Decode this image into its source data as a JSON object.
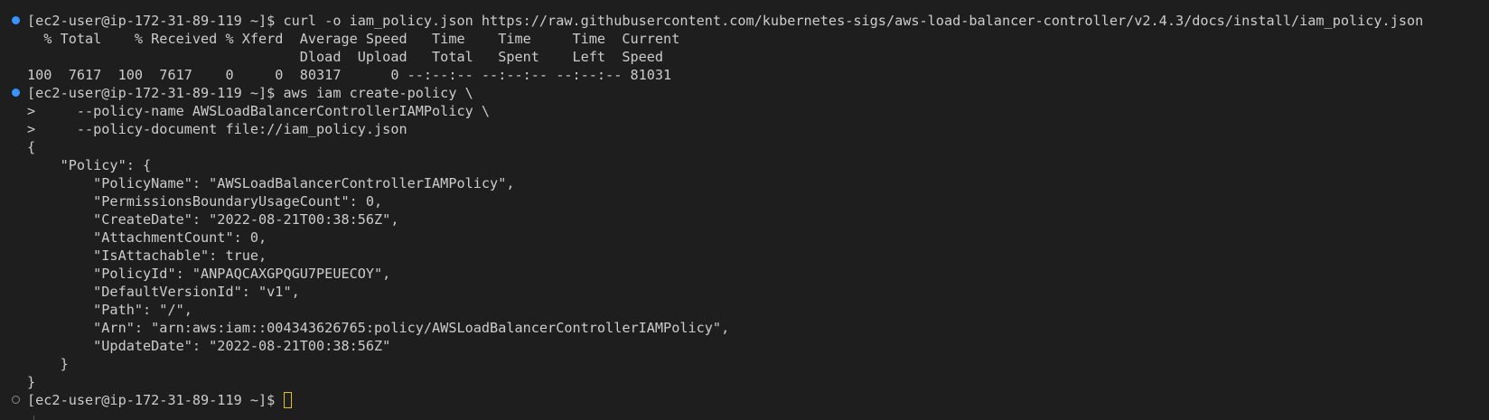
{
  "colors": {
    "background": "#1e1e1e",
    "text": "#cccccc",
    "success_marker": "#3794ff",
    "pending_marker": "#8a8a8a",
    "cursor": "#e8c400"
  },
  "terminal": {
    "lines": [
      "[ec2-user@ip-172-31-89-119 ~]$ curl -o iam_policy.json https://raw.githubusercontent.com/kubernetes-sigs/aws-load-balancer-controller/v2.4.3/docs/install/iam_policy.json",
      "  % Total    % Received % Xferd  Average Speed   Time    Time     Time  Current",
      "                                 Dload  Upload   Total   Spent    Left  Speed",
      "100  7617  100  7617    0     0  80317      0 --:--:-- --:--:-- --:--:-- 81031",
      "[ec2-user@ip-172-31-89-119 ~]$ aws iam create-policy \\",
      ">     --policy-name AWSLoadBalancerControllerIAMPolicy \\",
      ">     --policy-document file://iam_policy.json",
      "{",
      "    \"Policy\": {",
      "        \"PolicyName\": \"AWSLoadBalancerControllerIAMPolicy\",",
      "        \"PermissionsBoundaryUsageCount\": 0,",
      "        \"CreateDate\": \"2022-08-21T00:38:56Z\",",
      "        \"AttachmentCount\": 0,",
      "        \"IsAttachable\": true,",
      "        \"PolicyId\": \"ANPAQCAXGPQGU7PEUECOY\",",
      "        \"DefaultVersionId\": \"v1\",",
      "        \"Path\": \"/\",",
      "        \"Arn\": \"arn:aws:iam::004343626765:policy/AWSLoadBalancerControllerIAMPolicy\",",
      "        \"UpdateDate\": \"2022-08-21T00:38:56Z\"",
      "    }",
      "}"
    ],
    "prompt": "[ec2-user@ip-172-31-89-119 ~]$ ",
    "command_markers": {
      "curl_command": "success",
      "aws_command": "success",
      "current_prompt": "pending"
    }
  }
}
